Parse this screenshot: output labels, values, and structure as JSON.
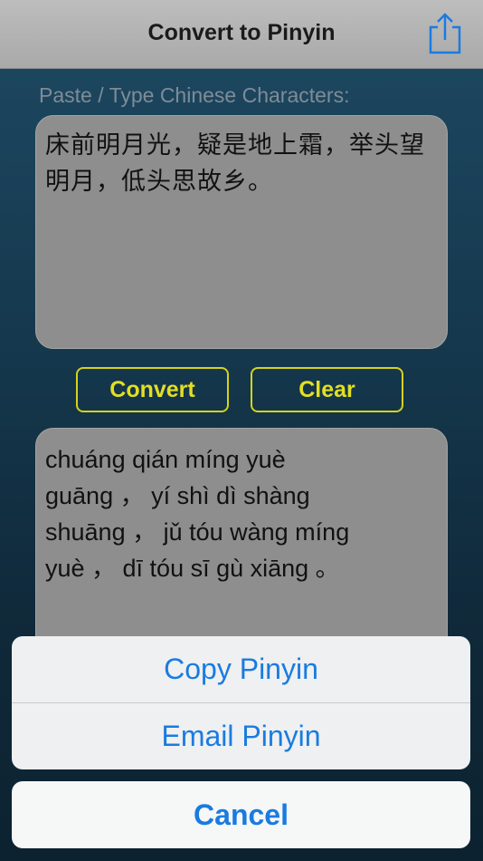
{
  "navbar": {
    "title": "Convert to Pinyin",
    "share_icon": "share-icon"
  },
  "input": {
    "label": "Paste / Type Chinese Characters:",
    "value": "床前明月光，疑是地上霜，举头望明月，低头思故乡。"
  },
  "buttons": {
    "convert": "Convert",
    "clear": "Clear"
  },
  "output": {
    "lines": [
      "chuáng qián míng yuè",
      "guāng ，  yí shì dì shàng",
      "shuāng ，  jǔ tóu wàng míng",
      "yuè ，  dī tóu sī gù xiāng 。"
    ]
  },
  "action_sheet": {
    "copy": "Copy Pinyin",
    "email": "Email Pinyin",
    "cancel": "Cancel"
  },
  "colors": {
    "accent_yellow": "#e3df22",
    "ios_blue": "#1a7be0",
    "field_gray": "#8e8e8e"
  }
}
